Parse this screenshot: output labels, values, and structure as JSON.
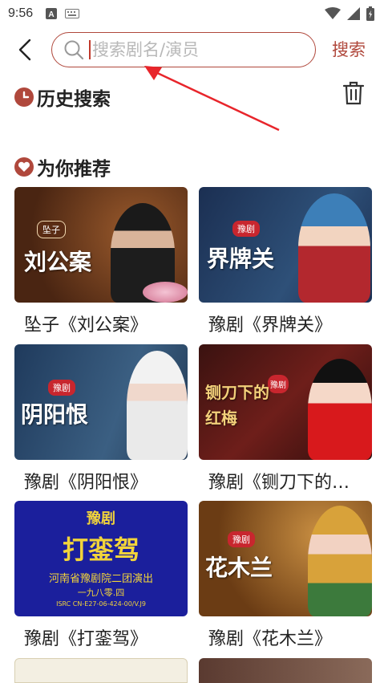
{
  "status_bar": {
    "time": "9:56"
  },
  "search": {
    "placeholder": "搜索剧名/演员",
    "button_label": "搜索"
  },
  "history": {
    "title": "历史搜索"
  },
  "recommend": {
    "title": "为你推荐",
    "items": [
      {
        "title": "坠子《刘公案》",
        "thumb_text": "刘公案",
        "tag": "坠子"
      },
      {
        "title": "豫剧《界牌关》",
        "thumb_text": "界牌关",
        "tag": "豫剧"
      },
      {
        "title": "豫剧《阴阳恨》",
        "thumb_text": "阴阳恨",
        "tag": "豫剧"
      },
      {
        "title": "豫剧《铡刀下的红梅》",
        "thumb_text": "铡刀下的红梅",
        "tag": "豫剧"
      },
      {
        "title": "豫剧《打銮驾》",
        "thumb_text": "打銮驾",
        "tag": "豫剧",
        "sub1": "河南省豫剧院二团演出",
        "sub2": "一九八零.四",
        "sub3": "ISRC CN-E27-06-424-00/V.J9"
      },
      {
        "title": "豫剧《花木兰》",
        "thumb_text": "花木兰",
        "tag": "豫剧"
      }
    ]
  },
  "colors": {
    "accent": "#b0483c"
  }
}
